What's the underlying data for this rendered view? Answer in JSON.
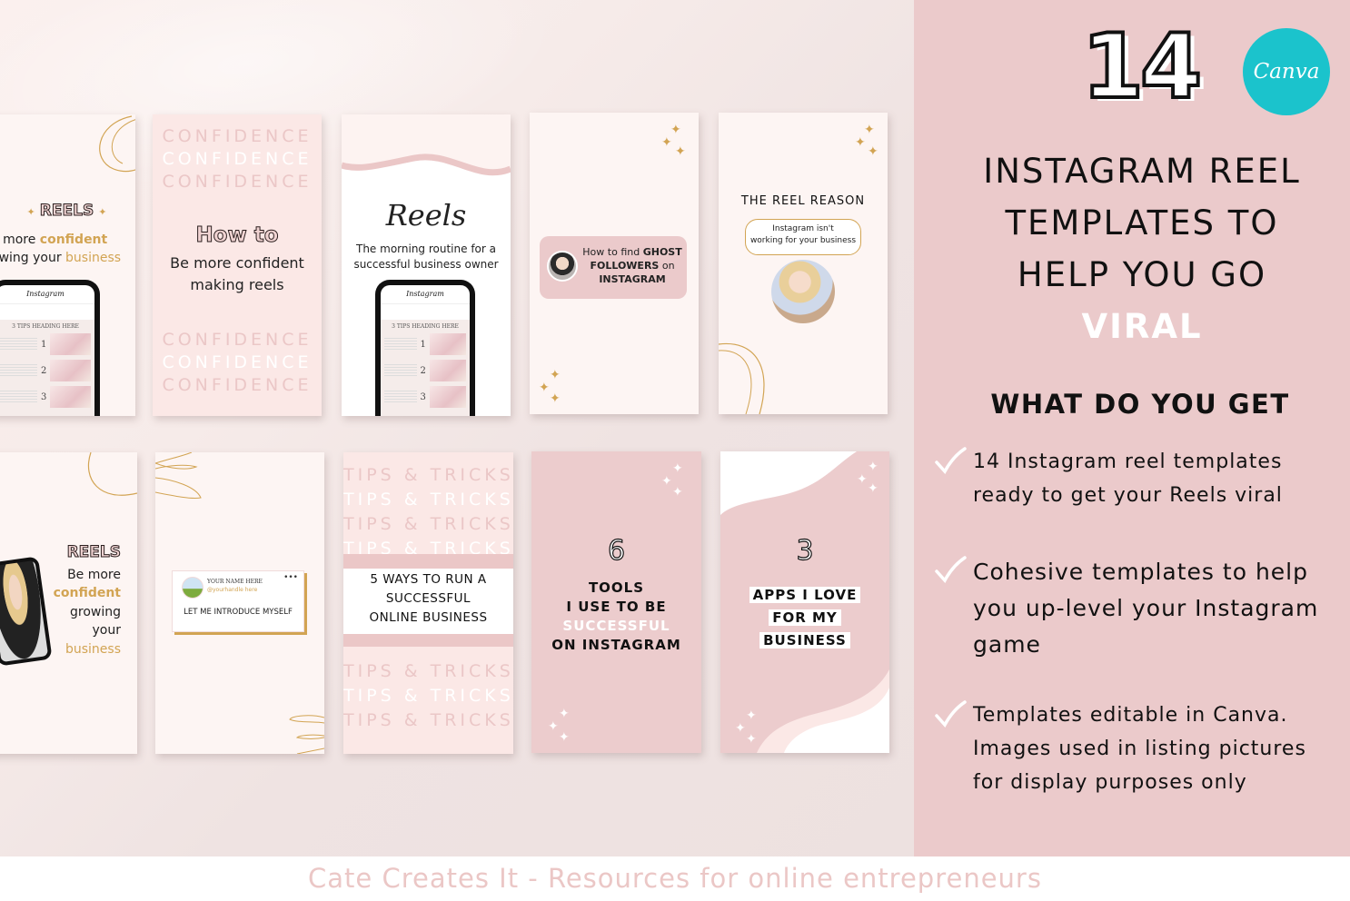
{
  "header": {
    "count": "14",
    "canva_badge": "Canva",
    "headline_lines": [
      "INSTAGRAM REEL",
      "TEMPLATES TO",
      "HELP YOU GO"
    ],
    "headline_highlight": "VIRAL"
  },
  "features": {
    "title": "WHAT DO YOU GET",
    "items": [
      {
        "icon": "checkmark-icon",
        "lines": [
          "14 Instagram reel templates",
          "ready to get your Reels viral"
        ]
      },
      {
        "icon": "checkmark-icon",
        "lines": [
          "Cohesive templates to help",
          "you up-level your Instagram",
          "game"
        ]
      },
      {
        "icon": "checkmark-icon",
        "lines": [
          "Templates editable in Canva.",
          "Images used in listing pictures",
          "for display purposes only"
        ]
      }
    ]
  },
  "footer": {
    "tagline": "Cate Creates It - Resources for online entrepreneurs"
  },
  "colors": {
    "panel": "#ebcacb",
    "accent_gold": "#d2a453",
    "canva_teal": "#1bc3cc",
    "footer_text": "#ebc7c6"
  },
  "templates": {
    "t1": {
      "title": "REELS",
      "line1_pre": "e more ",
      "line1_em": "confident",
      "line2_pre": "owing your ",
      "line2_em": "business",
      "phone_app": "Instagram",
      "phone_heading": "3 TIPS HEADING HERE"
    },
    "t2": {
      "repeat_word": "CONFIDENCE",
      "title": "How to",
      "line1": "Be more confident",
      "line2": "making reels"
    },
    "t3": {
      "script_title": "Reels",
      "line1": "The morning routine for a",
      "line2": "successful business owner",
      "phone_app": "Instagram",
      "phone_heading": "3 TIPS HEADING HERE"
    },
    "t4": {
      "pre": "How to find ",
      "em1": "GHOST",
      "em2": "FOLLOWERS",
      "mid": " on",
      "em3": "INSTAGRAM"
    },
    "t5": {
      "title": "THE REEL REASON",
      "bubble_line1": "Instagram isn't",
      "bubble_line2": "working for your business"
    },
    "t6": {
      "title": "REELS",
      "line1": "Be more",
      "line2": "confident",
      "line3": "growing",
      "line4": "your",
      "line5": "business"
    },
    "t7": {
      "name": "YOUR NAME HERE",
      "handle": "@yourhandle here",
      "text": "LET ME INTRODUCE MYSELF"
    },
    "t8": {
      "repeat_word": "TIPS & TRICKS",
      "line1": "5 WAYS TO RUN A",
      "line2": "SUCCESSFUL",
      "line3": "ONLINE BUSINESS"
    },
    "t9": {
      "number": "6",
      "line1": "TOOLS",
      "line2": "I USE TO BE",
      "line3": "SUCCESSFUL",
      "line4": "ON INSTAGRAM"
    },
    "t10": {
      "number": "3",
      "line1": "APPS I LOVE",
      "line2": "FOR MY",
      "line3": "BUSINESS"
    }
  }
}
